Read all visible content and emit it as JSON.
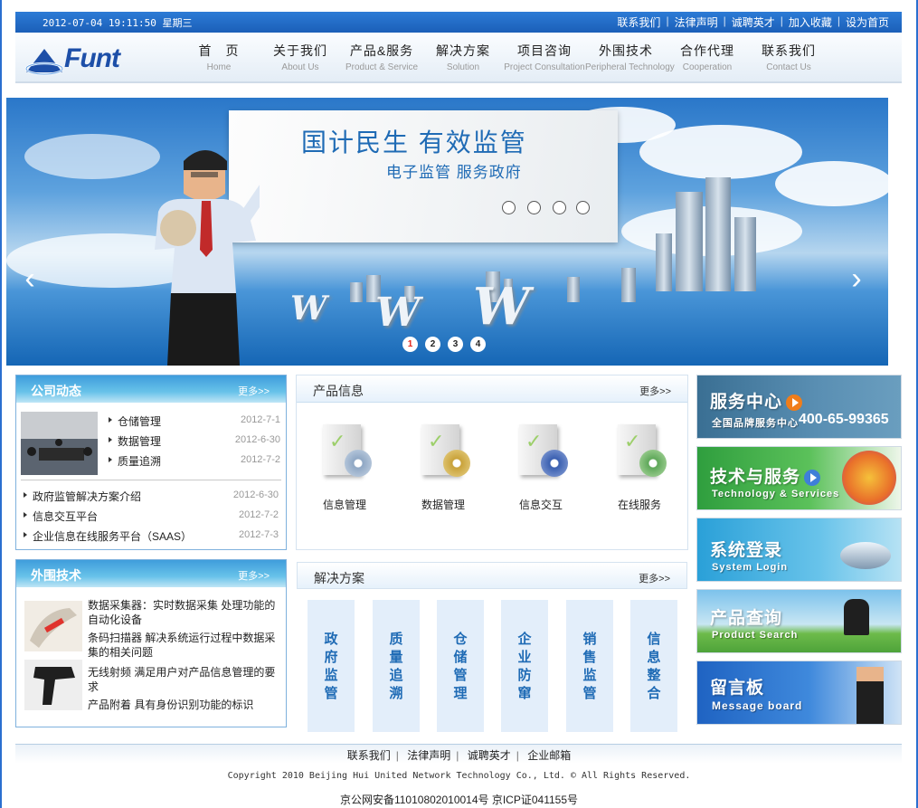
{
  "topbar": {
    "datetime": "2012-07-04 19:11:50 星期三",
    "links": [
      "联系我们",
      "法律声明",
      "诚聘英才",
      "加入收藏",
      "设为首页"
    ]
  },
  "header": {
    "logo_text": "Funt",
    "nav": [
      {
        "zh": "首　页",
        "en": "Home"
      },
      {
        "zh": "关于我们",
        "en": "About Us"
      },
      {
        "zh": "产品&服务",
        "en": "Product & Service"
      },
      {
        "zh": "解决方案",
        "en": "Solution"
      },
      {
        "zh": "项目咨询",
        "en": "Project Consultation"
      },
      {
        "zh": "外围技术",
        "en": "Peripheral Technology"
      },
      {
        "zh": "合作代理",
        "en": "Cooperation"
      },
      {
        "zh": "联系我们",
        "en": "Contact Us"
      }
    ]
  },
  "banner": {
    "headline": "国计民生 有效监管",
    "subline": "电子监管 服务政府",
    "prev": "‹",
    "next": "›",
    "slides": [
      "1",
      "2",
      "3",
      "4"
    ],
    "active_slide": 1
  },
  "company_news": {
    "title": "公司动态",
    "more": "更多>>",
    "featured": [
      {
        "text": "仓储管理",
        "date": "2012-7-1"
      },
      {
        "text": "数据管理",
        "date": "2012-6-30"
      },
      {
        "text": "质量追溯",
        "date": "2012-7-2"
      }
    ],
    "items": [
      {
        "text": "政府监管解决方案介绍",
        "date": "2012-6-30"
      },
      {
        "text": "信息交互平台",
        "date": "2012-7-2"
      },
      {
        "text": "企业信息在线服务平台（SAAS）",
        "date": "2012-7-3"
      }
    ]
  },
  "products": {
    "title": "产品信息",
    "more": "更多>>",
    "items": [
      {
        "label": "信息管理",
        "disc_color": "#8fa7c4"
      },
      {
        "label": "数据管理",
        "disc_color": "#c9a23a"
      },
      {
        "label": "信息交互",
        "disc_color": "#3a5fb0"
      },
      {
        "label": "在线服务",
        "disc_color": "#5fa85a"
      }
    ]
  },
  "peripheral": {
    "title": "外围技术",
    "more": "更多>>",
    "items": [
      "数据采集器：实时数据采集 处理功能的自动化设备",
      "条码扫描器 解决系统运行过程中数据采集的相关问题",
      "无线射频 满足用户对产品信息管理的要求",
      "产品附着 具有身份识别功能的标识"
    ]
  },
  "solutions": {
    "title": "解决方案",
    "more": "更多>>",
    "items": [
      "政府监管",
      "质量追溯",
      "仓储管理",
      "企业防窜",
      "销售监管",
      "信息整合"
    ]
  },
  "side_banners": [
    {
      "title": "服务中心",
      "sub": "全国品牌服务中心",
      "phone": "400-65-99365"
    },
    {
      "title": "技术与服务",
      "sub": "Technology & Services"
    },
    {
      "title": "系统登录",
      "sub": "System Login"
    },
    {
      "title": "产品查询",
      "sub": "Product Search"
    },
    {
      "title": "留言板",
      "sub": "Message board"
    }
  ],
  "footer": {
    "links": [
      "联系我们",
      "法律声明",
      "诚聘英才",
      "企业邮箱"
    ],
    "copyright": "Copyright 2010 Beijing Hui United Network Technology Co., Ltd. © All Rights Reserved.",
    "icp": "京公网安备11010802010014号 京ICP证041155号"
  }
}
